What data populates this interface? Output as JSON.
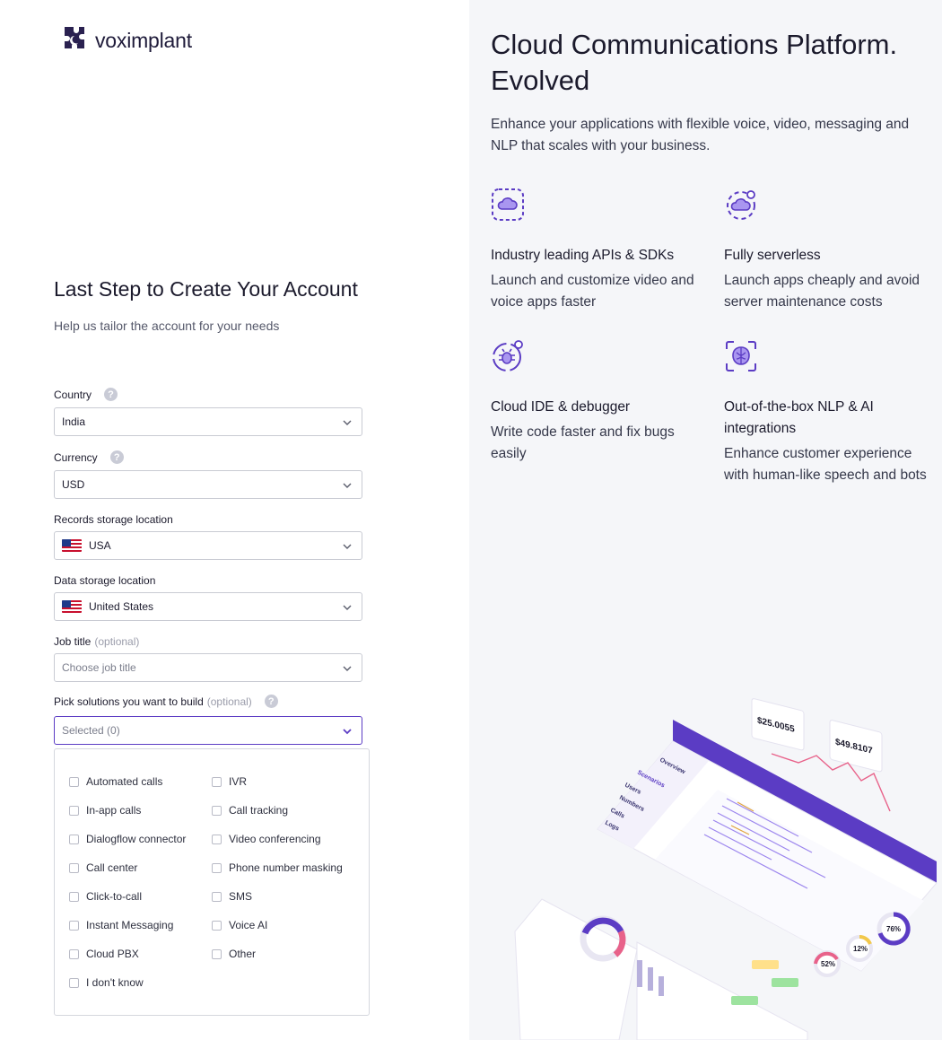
{
  "brand": {
    "name": "voximplant"
  },
  "form": {
    "title": "Last Step to Create Your Account",
    "subtitle": "Help us tailor the account for your needs",
    "fields": {
      "country": {
        "label": "Country",
        "value": "India"
      },
      "currency": {
        "label": "Currency",
        "value": "USD"
      },
      "records_storage": {
        "label": "Records storage location",
        "value": "USA"
      },
      "data_storage": {
        "label": "Data storage location",
        "value": "United States"
      },
      "job_title": {
        "label": "Job title",
        "optional": "(optional)",
        "placeholder": "Choose job title"
      },
      "solutions": {
        "label": "Pick solutions you want to build",
        "optional": "(optional)",
        "value": "Selected (0)"
      }
    },
    "solutions_options": {
      "col1": [
        "Automated calls",
        "In-app calls",
        "Dialogflow connector",
        "Call center",
        "Click-to-call",
        "Instant Messaging",
        "Cloud PBX",
        "I don't know"
      ],
      "col2": [
        "IVR",
        "Call tracking",
        "Video conferencing",
        "Phone number masking",
        "SMS",
        "Voice AI",
        "Other"
      ]
    },
    "help_glyph": "?"
  },
  "hero": {
    "title": "Cloud Communications Platform. Evolved",
    "subtitle": "Enhance your applications with flexible voice, video, messaging and NLP that scales with your business.",
    "features": [
      {
        "icon": "cloud-icon",
        "title": "Industry leading APIs & SDKs",
        "text": "Launch and customize video and voice apps faster"
      },
      {
        "icon": "serverless-icon",
        "title": "Fully serverless",
        "text": "Launch apps cheaply and avoid server maintenance costs"
      },
      {
        "icon": "bug-icon",
        "title": "Cloud IDE & debugger",
        "text": "Write code faster and fix bugs easily"
      },
      {
        "icon": "brain-icon",
        "title": "Out-of-the-box NLP & AI integrations",
        "text": "Enhance customer experience with human-like speech and bots"
      }
    ]
  },
  "illustration": {
    "price1": "$25.0055",
    "price2": "$49.8107",
    "nav": [
      "Overview",
      "Scenarios",
      "Users",
      "Numbers",
      "Calls",
      "Logs"
    ],
    "gauges": [
      "76%",
      "12%",
      "52%"
    ]
  },
  "colors": {
    "accent": "#5b3cc4",
    "panel_bg": "#f5f6f9",
    "icon": "#5b3cc4"
  }
}
